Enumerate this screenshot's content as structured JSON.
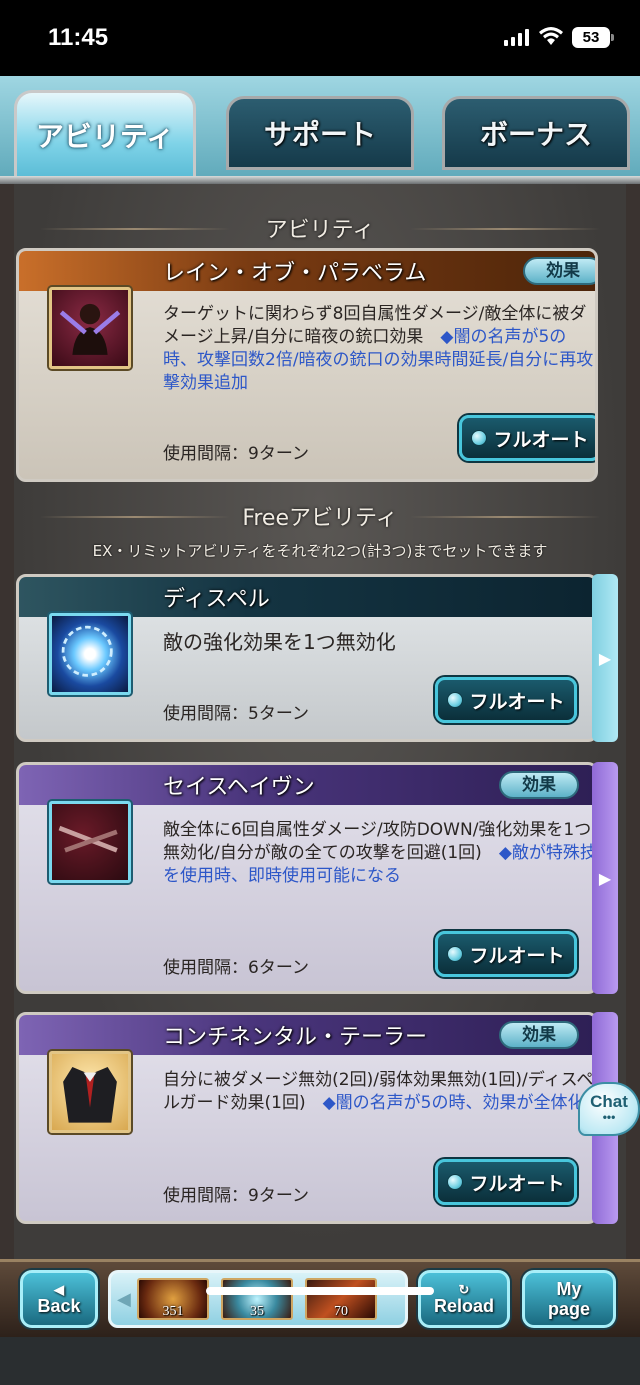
{
  "status": {
    "time": "11:45",
    "battery": "53"
  },
  "tabs": [
    {
      "label": "アビリティ",
      "active": true
    },
    {
      "label": "サポート",
      "active": false
    },
    {
      "label": "ボーナス",
      "active": false
    }
  ],
  "sections": {
    "ability": "アビリティ",
    "free": "Freeアビリティ",
    "free_note": "EX・リミットアビリティをそれぞれ2つ(計3つ)までセットできます"
  },
  "cards": [
    {
      "name": "レイン・オブ・パラベラム",
      "badge": "効果",
      "desc_main": "ターゲットに関わらず8回自属性ダメージ/敵全体に被ダメージ上昇/自分に暗夜の銃口効果　",
      "desc_hl": "◆闇の名声が5の時、攻撃回数2倍/暗夜の銃口の効果時間延長/自分に再攻撃効果追加",
      "interval": "使用間隔：9ターン",
      "button": "フルオート"
    },
    {
      "name": "ディスペル",
      "badge": "",
      "desc_main": "敵の強化効果を1つ無効化",
      "desc_hl": "",
      "interval": "使用間隔：5ターン",
      "button": "フルオート"
    },
    {
      "name": "セイスヘイヴン",
      "badge": "効果",
      "desc_main": "敵全体に6回自属性ダメージ/攻防DOWN/強化効果を1つ無効化/自分が敵の全ての攻撃を回避(1回)　",
      "desc_hl": "◆敵が特殊技を使用時、即時使用可能になる",
      "interval": "使用間隔：6ターン",
      "button": "フルオート"
    },
    {
      "name": "コンチネンタル・テーラー",
      "badge": "効果",
      "desc_main": "自分に被ダメージ無効(2回)/弱体効果無効(1回)/ディスペルガード効果(1回)　",
      "desc_hl": "◆闇の名声が5の時、効果が全体化",
      "interval": "使用間隔：9ターン",
      "button": "フルオート"
    }
  ],
  "chat": {
    "label": "Chat"
  },
  "bottom": {
    "back": "Back",
    "reload": "Reload",
    "mypage_line1": "My",
    "mypage_line2": "page",
    "items": [
      {
        "count": "351",
        "icon": "orb-icon"
      },
      {
        "count": "35",
        "icon": "crystal-icon"
      },
      {
        "count": "70",
        "icon": "potion-icon"
      }
    ]
  }
}
